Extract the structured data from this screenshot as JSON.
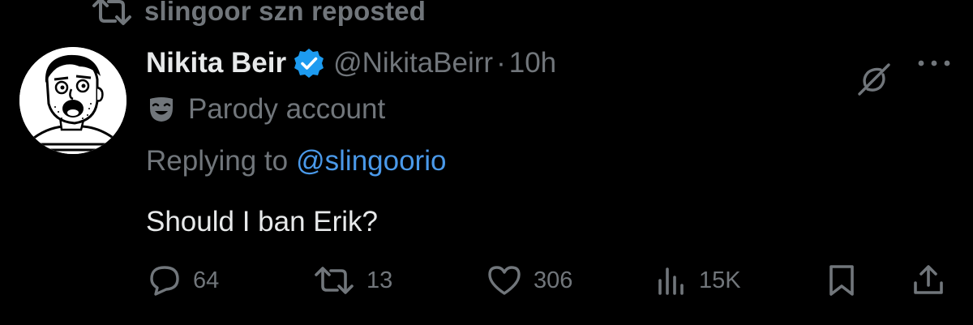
{
  "repost_banner": {
    "text": "slingoor szn reposted"
  },
  "author": {
    "display_name": "Nikita Beir",
    "handle": "@NikitaBeirr",
    "separator": "·",
    "time": "10h",
    "verified": true,
    "badge_label": "Parody account"
  },
  "reply_context": {
    "prefix": "Replying to",
    "handle": "@slingoorio"
  },
  "tweet": {
    "text": "Should I ban Erik?"
  },
  "actions": {
    "reply_count": "64",
    "repost_count": "13",
    "like_count": "306",
    "view_count": "15K"
  },
  "icons": {
    "repost_banner": "repost-icon",
    "verified": "verified-badge-icon",
    "grok": "grok-icon",
    "more": "more-horizontal-icon",
    "parody": "theater-mask-icon",
    "reply": "reply-bubble-icon",
    "repost": "repost-icon",
    "like": "heart-icon",
    "views": "views-bar-chart-icon",
    "bookmark": "bookmark-icon",
    "share": "share-upload-icon"
  },
  "colors": {
    "background": "#000000",
    "primary_text": "#e7e9ea",
    "secondary_text": "#71767b",
    "link": "#4a99e9",
    "verified_badge": "#1d9bf0"
  }
}
